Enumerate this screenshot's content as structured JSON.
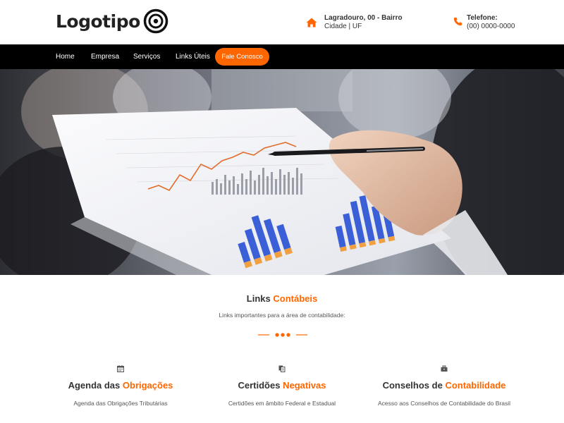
{
  "header": {
    "logo_text": "Logotipo",
    "address_line1": "Lagradouro, 00 - Bairro",
    "address_line2": "Cidade | UF",
    "phone_label": "Telefone:",
    "phone_number": "(00) 0000-0000"
  },
  "nav": {
    "items": [
      "Home",
      "Empresa",
      "Serviços",
      "Links Úteis"
    ],
    "cta": "Fale Conosco"
  },
  "section": {
    "title_plain": "Links",
    "title_highlight": "Contábeis",
    "subtitle": "Links importantes para a área de contabilidade:"
  },
  "columns": [
    {
      "icon": "calendar-icon",
      "title_plain": "Agenda das",
      "title_highlight": "Obrigações",
      "description": "Agenda das Obrigações Tributárias"
    },
    {
      "icon": "documents-icon",
      "title_plain": "Certidões",
      "title_highlight": "Negativas",
      "description": "Certidões em âmbito Federal e Estadual"
    },
    {
      "icon": "briefcase-icon",
      "title_plain": "Conselhos de",
      "title_highlight": "Contabilidade",
      "description": "Acesso aos Conselhos de Contabilidade do Brasil"
    }
  ],
  "colors": {
    "accent": "#ff6600",
    "nav_bg": "#000000",
    "text": "#333333"
  }
}
